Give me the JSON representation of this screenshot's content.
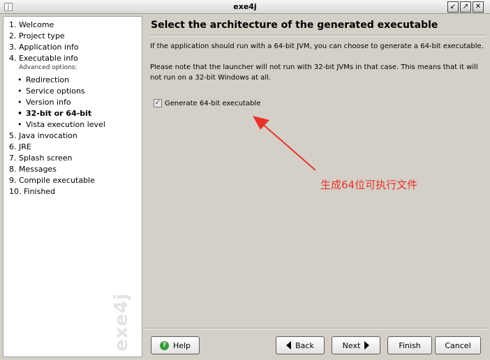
{
  "window": {
    "title": "exe4j"
  },
  "sidebar": {
    "steps": [
      {
        "label": "1. Welcome"
      },
      {
        "label": "2. Project type"
      },
      {
        "label": "3. Application info"
      },
      {
        "label": "4. Executable info"
      },
      {
        "label": "5. Java invocation"
      },
      {
        "label": "6. JRE"
      },
      {
        "label": "7. Splash screen"
      },
      {
        "label": "8. Messages"
      },
      {
        "label": "9. Compile executable"
      },
      {
        "label": "10. Finished"
      }
    ],
    "advanced_label": "Advanced options:",
    "substeps": [
      {
        "label": "Redirection"
      },
      {
        "label": "Service options"
      },
      {
        "label": "Version info"
      },
      {
        "label": "32-bit or 64-bit"
      },
      {
        "label": "Vista execution level"
      }
    ],
    "watermark": "exe4j"
  },
  "main": {
    "heading": "Select the architecture of the generated executable",
    "paragraph1": "If the application should run with a 64-bit JVM, you can choose to generate a 64-bit executable.",
    "paragraph2": "Please note that the launcher will not run with 32-bit JVMs in that case. This means that it will not run on a 32-bit Windows at all.",
    "checkbox_label": "Generate 64-bit executable",
    "checkbox_checked": true
  },
  "annotation": {
    "text": "生成64位可执行文件",
    "color": "#e8332a"
  },
  "buttons": {
    "help": "Help",
    "back": "Back",
    "next": "Next",
    "finish": "Finish",
    "cancel": "Cancel"
  }
}
